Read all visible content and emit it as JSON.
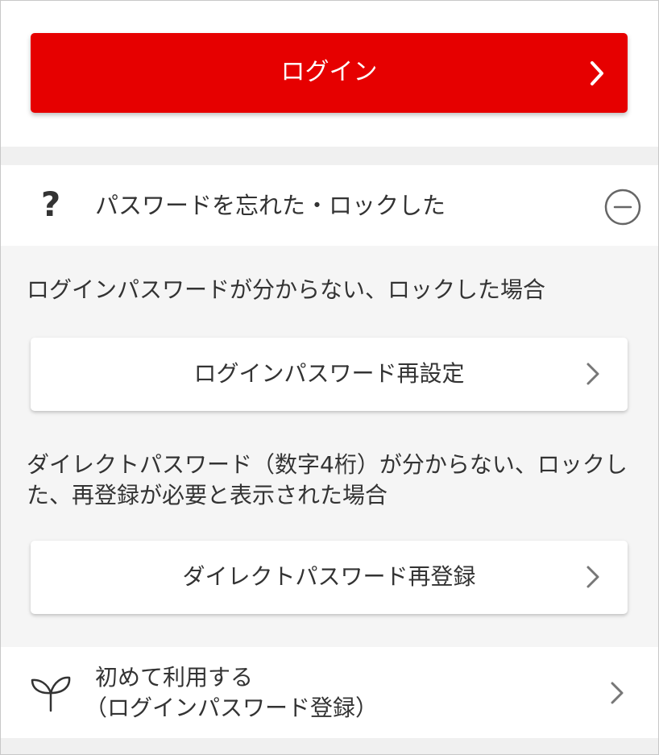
{
  "login_button": {
    "label": "ログイン",
    "icon": "chevron-right-icon",
    "color": "#e60000"
  },
  "forgot_section": {
    "icon": "question-icon",
    "title": "パスワードを忘れた・ロックした",
    "toggle_icon": "collapse-minus-icon",
    "login_password_desc": "ログインパスワードが分からない、ロックした場合",
    "login_password_reset_label": "ログインパスワード再設定",
    "direct_password_desc": "ダイレクトパスワード（数字4桁）が分からない、ロックした、再登録が必要と表示された場合",
    "direct_password_reregister_label": "ダイレクトパスワード再登録"
  },
  "first_use": {
    "icon": "sprout-icon",
    "title": "初めて利用する",
    "subtitle": "（ログインパスワード登録）"
  }
}
